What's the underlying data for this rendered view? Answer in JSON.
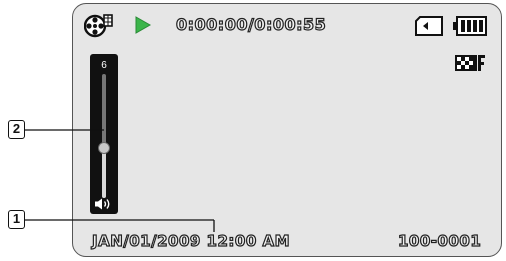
{
  "status": {
    "timecode": "0:00:00/0:00:55",
    "mode_icon": "movie-mode-icon",
    "play_icon": "play-icon",
    "play_color": "#3bb54a",
    "storage_icon": "memory-card-icon",
    "battery_icon": "battery-full-icon",
    "quality_icon": "super-fine-quality-icon"
  },
  "volume": {
    "level": 6,
    "label": "6",
    "icon": "speaker-icon"
  },
  "footer": {
    "datetime": "JAN/01/2009 12:00 AM",
    "file_number": "100-0001"
  },
  "callouts": [
    {
      "label": "1"
    },
    {
      "label": "2"
    }
  ]
}
